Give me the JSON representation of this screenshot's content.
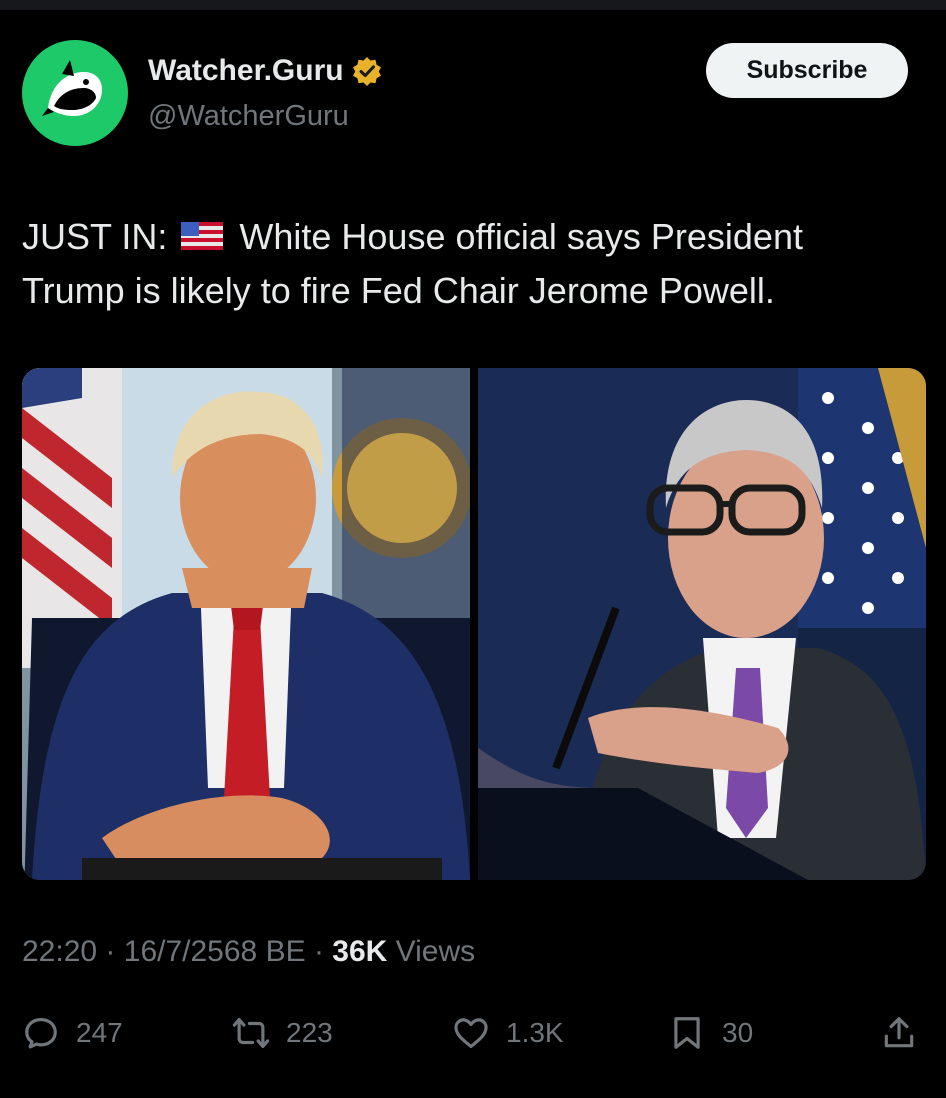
{
  "account": {
    "display_name": "Watcher.Guru",
    "handle": "@WatcherGuru",
    "avatar_icon": "orca-whale-icon",
    "verified_icon": "gold-verified-badge-icon",
    "avatar_color": "#1ec96a",
    "verified_color": "#e8b22a"
  },
  "subscribe_label": "Subscribe",
  "tweet": {
    "prefix": "JUST IN:",
    "flag_icon": "us-flag-icon",
    "text_line1_rest": "White House official says President",
    "text_line2": "Trump is likely to fire Fed Chair Jerome Powell."
  },
  "media": {
    "photo1_icon": "man-in-navy-suit-red-tie-photo",
    "photo2_icon": "man-with-glasses-at-podium-photo"
  },
  "meta": {
    "time": "22:20",
    "sep1": "·",
    "date": "16/7/2568 BE",
    "sep2": "·",
    "views_count": "36K",
    "views_label": "Views"
  },
  "actions": {
    "replies": "247",
    "reposts": "223",
    "likes": "1.3K",
    "bookmarks": "30",
    "reply_icon": "reply-icon",
    "repost_icon": "repost-icon",
    "like_icon": "heart-icon",
    "bookmark_icon": "bookmark-icon",
    "share_icon": "share-icon"
  }
}
